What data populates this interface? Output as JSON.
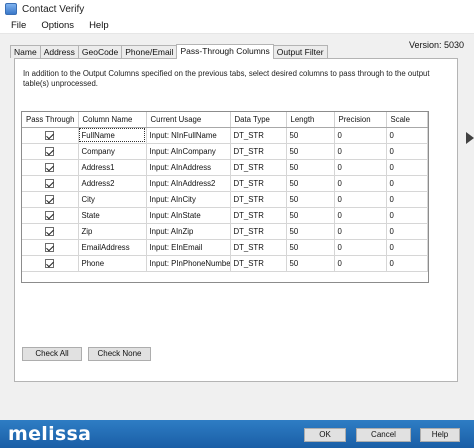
{
  "window": {
    "title": "Contact Verify",
    "icon": "app-icon"
  },
  "menu": {
    "items": [
      "File",
      "Options",
      "Help"
    ]
  },
  "version": "Version: 5030",
  "tabs": [
    "Name",
    "Address",
    "GeoCode",
    "Phone/Email",
    "Pass-Through Columns",
    "Output Filter"
  ],
  "active_tab": "Pass-Through Columns",
  "description": "In addition to the Output Columns specified on the previous tabs, select desired columns to pass through to the output table(s) unprocessed.",
  "table": {
    "headers": [
      "Pass Through",
      "Column Name",
      "Current Usage",
      "Data Type",
      "Length",
      "Precision",
      "Scale"
    ],
    "rows": [
      {
        "pass": true,
        "name": "FullName",
        "usage": "Input: NInFullName",
        "type": "DT_STR",
        "length": "50",
        "precision": "0",
        "scale": "0"
      },
      {
        "pass": true,
        "name": "Company",
        "usage": "Input: AInCompany",
        "type": "DT_STR",
        "length": "50",
        "precision": "0",
        "scale": "0"
      },
      {
        "pass": true,
        "name": "Address1",
        "usage": "Input: AInAddress",
        "type": "DT_STR",
        "length": "50",
        "precision": "0",
        "scale": "0"
      },
      {
        "pass": true,
        "name": "Address2",
        "usage": "Input: AInAddress2",
        "type": "DT_STR",
        "length": "50",
        "precision": "0",
        "scale": "0"
      },
      {
        "pass": true,
        "name": "City",
        "usage": "Input: AInCity",
        "type": "DT_STR",
        "length": "50",
        "precision": "0",
        "scale": "0"
      },
      {
        "pass": true,
        "name": "State",
        "usage": "Input: AInState",
        "type": "DT_STR",
        "length": "50",
        "precision": "0",
        "scale": "0"
      },
      {
        "pass": true,
        "name": "Zip",
        "usage": "Input: AInZip",
        "type": "DT_STR",
        "length": "50",
        "precision": "0",
        "scale": "0"
      },
      {
        "pass": true,
        "name": "EmailAddress",
        "usage": "Input: EInEmail",
        "type": "DT_STR",
        "length": "50",
        "precision": "0",
        "scale": "0"
      },
      {
        "pass": true,
        "name": "Phone",
        "usage": "Input: PInPhoneNumber",
        "type": "DT_STR",
        "length": "50",
        "precision": "0",
        "scale": "0"
      }
    ]
  },
  "buttons": {
    "check_all": "Check All",
    "check_none": "Check None",
    "ok": "OK",
    "cancel": "Cancel",
    "help": "Help"
  },
  "brand": "melissa",
  "colors": {
    "brand_bar": "#1f6bb3",
    "panel_bg": "#f0f0f0"
  }
}
